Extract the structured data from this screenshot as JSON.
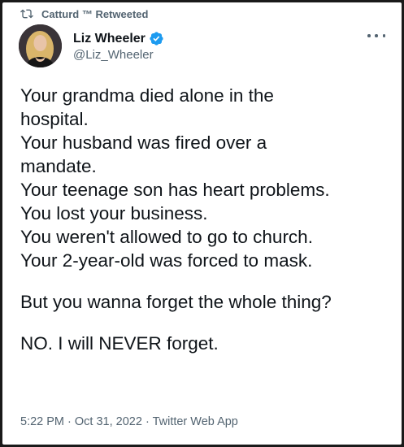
{
  "retweet": {
    "label": "Catturd ™ Retweeted",
    "icon": "retweet-icon"
  },
  "author": {
    "display_name": "Liz Wheeler",
    "handle": "@Liz_Wheeler",
    "verified": true,
    "verified_color": "#1d9bf0"
  },
  "tweet": {
    "lines": [
      "Your grandma died alone in the",
      "hospital.",
      "Your husband was fired over a",
      "mandate.",
      "Your teenage son has heart problems.",
      "You lost your business.",
      "You weren't allowed to go to church.",
      "Your 2-year-old was forced to mask."
    ],
    "question": "But you wanna forget the whole thing?",
    "closing": "NO. I will NEVER forget."
  },
  "meta": {
    "time": "5:22 PM",
    "date": "Oct 31, 2022",
    "source": "Twitter Web App",
    "separator": "·"
  },
  "colors": {
    "text": "#0f1419",
    "secondary": "#536471",
    "frame": "#1a1a1a"
  }
}
